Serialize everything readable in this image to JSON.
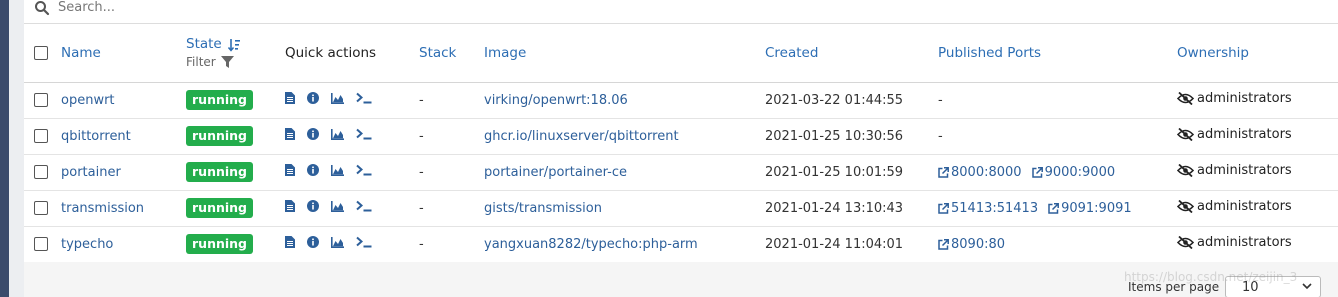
{
  "search": {
    "placeholder": "Search..."
  },
  "columns": {
    "name": "Name",
    "state": "State",
    "state_filter": "Filter",
    "quick_actions": "Quick actions",
    "stack": "Stack",
    "image": "Image",
    "created": "Created",
    "ports": "Published Ports",
    "ownership": "Ownership"
  },
  "containers": [
    {
      "name": "openwrt",
      "state": "running",
      "stack": "-",
      "image": "virking/openwrt:18.06",
      "created": "2021-03-22 01:44:55",
      "ports": [],
      "ports_empty": "-",
      "ownership": "administrators"
    },
    {
      "name": "qbittorrent",
      "state": "running",
      "stack": "-",
      "image": "ghcr.io/linuxserver/qbittorrent",
      "created": "2021-01-25 10:30:56",
      "ports": [],
      "ports_empty": "-",
      "ownership": "administrators"
    },
    {
      "name": "portainer",
      "state": "running",
      "stack": "-",
      "image": "portainer/portainer-ce",
      "created": "2021-01-25 10:01:59",
      "ports": [
        "8000:8000",
        "9000:9000"
      ],
      "ports_empty": "",
      "ownership": "administrators"
    },
    {
      "name": "transmission",
      "state": "running",
      "stack": "-",
      "image": "gists/transmission",
      "created": "2021-01-24 13:10:43",
      "ports": [
        "51413:51413",
        "9091:9091"
      ],
      "ports_empty": "",
      "ownership": "administrators"
    },
    {
      "name": "typecho",
      "state": "running",
      "stack": "-",
      "image": "yangxuan8282/typecho:php-arm",
      "created": "2021-01-24 11:04:01",
      "ports": [
        "8090:80"
      ],
      "ports_empty": "",
      "ownership": "administrators"
    }
  ],
  "footer": {
    "items_per_page_label": "Items per page",
    "items_per_page_value": "10"
  },
  "watermark": "https://blog.csdn.net/zeijin_3",
  "colors": {
    "running_badge": "#23ad4c",
    "link": "#2d5f9a",
    "sidebar": "#3b4b6b"
  },
  "icons": {
    "search": "search-icon",
    "sort": "sort-icon",
    "filter": "filter-icon",
    "logs": "file-icon",
    "inspect": "info-icon",
    "stats": "chart-icon",
    "console": "terminal-icon",
    "port_link": "external-link-icon",
    "ownership": "eye-slash-icon"
  }
}
